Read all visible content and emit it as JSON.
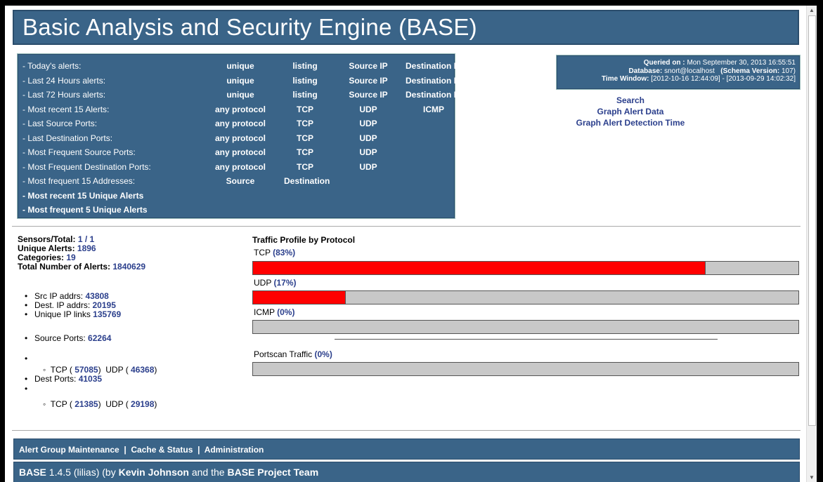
{
  "header": {
    "title": "Basic Analysis and Security Engine (BASE)"
  },
  "menu": {
    "rows": [
      {
        "label": "- Today's alerts:",
        "bold": false,
        "cols": [
          "unique",
          "listing",
          "Source IP",
          "Destination IP"
        ]
      },
      {
        "label": "- Last 24 Hours alerts:",
        "bold": false,
        "cols": [
          "unique",
          "listing",
          "Source IP",
          "Destination IP"
        ]
      },
      {
        "label": "- Last 72 Hours alerts:",
        "bold": false,
        "cols": [
          "unique",
          "listing",
          "Source IP",
          "Destination IP"
        ]
      },
      {
        "label": "- Most recent 15 Alerts:",
        "bold": false,
        "cols": [
          "any protocol",
          "TCP",
          "UDP",
          "ICMP"
        ]
      },
      {
        "label": "- Last Source Ports:",
        "bold": false,
        "cols": [
          "any protocol",
          "TCP",
          "UDP",
          ""
        ]
      },
      {
        "label": "- Last Destination Ports:",
        "bold": false,
        "cols": [
          "any protocol",
          "TCP",
          "UDP",
          ""
        ]
      },
      {
        "label": "- Most Frequent Source Ports:",
        "bold": false,
        "cols": [
          "any protocol",
          "TCP",
          "UDP",
          ""
        ]
      },
      {
        "label": "- Most Frequent Destination Ports:",
        "bold": false,
        "cols": [
          "any protocol",
          "TCP",
          "UDP",
          ""
        ]
      },
      {
        "label": "- Most frequent 15 Addresses:",
        "bold": false,
        "cols": [
          "Source",
          "Destination",
          "",
          ""
        ]
      },
      {
        "label": "- Most recent 15 Unique Alerts",
        "bold": true,
        "cols": [
          "",
          "",
          "",
          ""
        ]
      },
      {
        "label": "- Most frequent 5 Unique Alerts",
        "bold": true,
        "cols": [
          "",
          "",
          "",
          ""
        ]
      }
    ]
  },
  "info": {
    "queried_label": "Queried on :",
    "queried_value": "Mon September 30, 2013 16:55:51",
    "database_label": "Database:",
    "database_value": "snort@localhost",
    "schema_label": "(Schema Version:",
    "schema_value": "107)",
    "window_label": "Time Window:",
    "window_value": "[2012-10-16 12:44:09] - [2013-09-29 14:02:32]"
  },
  "links": {
    "search": "Search",
    "graph_alert": "Graph Alert Data",
    "graph_time": "Graph Alert Detection Time"
  },
  "stats": {
    "sensors_label": "Sensors/Total:",
    "sensors_value": "1 / 1",
    "unique_label": "Unique Alerts:",
    "unique_value": "1896",
    "categories_label": "Categories:",
    "categories_value": "19",
    "total_label": "Total Number of Alerts:",
    "total_value": "1840629",
    "src_ip_label": "Src IP addrs:",
    "src_ip_value": "43808",
    "dst_ip_label": "Dest. IP addrs:",
    "dst_ip_value": "20195",
    "links_label": "Unique IP links",
    "links_value": "135769",
    "src_ports_label": "Source Ports:",
    "src_ports_value": "62264",
    "src_tcp_value": "57085",
    "src_udp_value": "46368",
    "dst_ports_label": "Dest Ports:",
    "dst_ports_value": "41035",
    "dst_tcp_value": "21385",
    "dst_udp_value": "29198",
    "tcp_label": "TCP (",
    "udp_label": "UDP (",
    "close_paren": ")"
  },
  "traffic": {
    "title": "Traffic Profile by Protocol",
    "tcp_label": "TCP",
    "tcp_pct": "(83%)",
    "tcp_fraction": 0.83,
    "udp_label": "UDP",
    "udp_pct": "(17%)",
    "udp_fraction": 0.17,
    "icmp_label": "ICMP",
    "icmp_pct": "(0%)",
    "icmp_fraction": 0,
    "portscan_label": "Portscan Traffic",
    "portscan_pct": "(0%)",
    "portscan_fraction": 0
  },
  "footer": {
    "maint": "Alert Group Maintenance",
    "cache": "Cache & Status",
    "admin": "Administration",
    "sep": "|",
    "base": "BASE",
    "version": "1.4.5 (lilias) (by",
    "author": "Kevin Johnson",
    "and_the": "and the",
    "team": "BASE Project Team"
  }
}
